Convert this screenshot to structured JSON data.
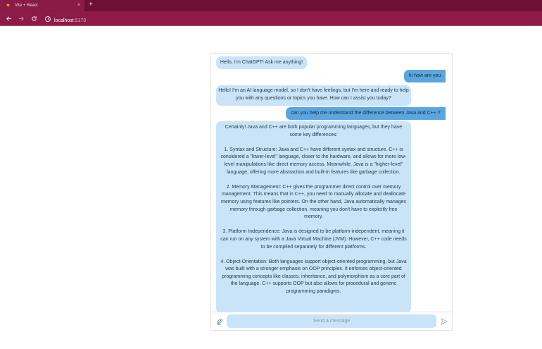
{
  "browser": {
    "tab_title": "Vite + React",
    "tab_close": "×",
    "new_tab": "+",
    "url_host": "localhost",
    "url_port": ":5173"
  },
  "chat": {
    "messages": [
      {
        "role": "bot",
        "text": "Hello, I'm ChatGPT! Ask me anything!"
      },
      {
        "role": "user",
        "text": "hi how are you"
      },
      {
        "role": "bot",
        "text": "Hello! I'm an AI language model, so I don't have feelings, but I'm here and ready to help you with any questions or topics you have. How can I assist you today?"
      },
      {
        "role": "user",
        "text": "can you help me understand the difference between Java and C++ ?"
      },
      {
        "role": "bot",
        "paragraphs": [
          "Certainly! Java and C++ are both popular programming languages, but they have some key differences:",
          "1. Syntax and Structure: Java and C++ have different syntax and structure. C++ is considered a \"lower-level\" language, closer to the hardware, and allows for more low-level manipulations like direct memory access. Meanwhile, Java is a \"higher-level\" language, offering more abstraction and built-in features like garbage collection.",
          "2. Memory Management: C++ gives the programmer direct control over memory management. This means that in C++, you need to manually allocate and deallocate memory using features like pointers. On the other hand, Java automatically manages memory through garbage collection, meaning you don't have to explicitly free memory.",
          "3. Platform Independence: Java is designed to be platform-independent, meaning it can run on any system with a Java Virtual Machine (JVM). However, C++ code needs to be compiled separately for different platforms.",
          "4. Object-Orientation: Both languages support object-oriented programming, but Java was built with a stronger emphasis on OOP principles. It enforces object-oriented programming concepts like classes, inheritance, and polymorphism as a core part of the language. C++ supports OOP but also allows for procedural and generic programming paradigms."
        ]
      }
    ],
    "input_placeholder": "Send a message"
  },
  "icons": {
    "tab": "vite-logo-icon",
    "back": "arrow-left-icon",
    "forward": "arrow-right-icon",
    "reload": "reload-icon",
    "site_info": "info-icon",
    "attach": "paperclip-icon",
    "send": "send-icon"
  },
  "colors": {
    "tabbar": "#6e0f35",
    "toolbar": "#8c1b48",
    "bot_bubble": "#c9e4f8",
    "user_bubble": "#5aa6e0"
  }
}
